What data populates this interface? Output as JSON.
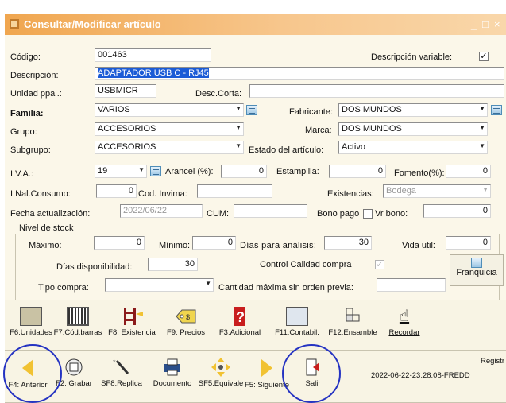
{
  "window": {
    "title": "Consultar/Modificar artículo",
    "controls": [
      "_",
      "□",
      "×"
    ]
  },
  "form": {
    "codigo_label": "Código:",
    "codigo_value": "001463",
    "desc_variable_label": "Descripción variable:",
    "desc_variable_checked": "✓",
    "descripcion_label": "Descripción:",
    "descripcion_value": "ADAPTADOR USB C - RJ45",
    "unidad_label": "Unidad ppal.:",
    "unidad_value": "USBMICR",
    "desc_corta_label": "Desc.Corta:",
    "desc_corta_value": "",
    "familia_label": "Familia:",
    "familia_value": "VARIOS",
    "fabricante_label": "Fabricante:",
    "fabricante_value": "DOS MUNDOS",
    "grupo_label": "Grupo:",
    "grupo_value": "ACCESORIOS",
    "marca_label": "Marca:",
    "marca_value": "DOS MUNDOS",
    "subgrupo_label": "Subgrupo:",
    "subgrupo_value": "ACCESORIOS",
    "estado_label": "Estado del artículo:",
    "estado_value": "Activo",
    "iva_label": "I.V.A.:",
    "iva_value": "19",
    "arancel_label": "Arancel (%):",
    "arancel_value": "0",
    "estampilla_label": "Estampilla:",
    "estampilla_value": "0",
    "fomento_label": "Fomento(%):",
    "fomento_value": "0",
    "inal_label": "I.Nal.Consumo:",
    "inal_value": "0",
    "invima_label": "Cod. Invima:",
    "invima_value": "",
    "existencias_label": "Existencias:",
    "existencias_value": "Bodega",
    "fecha_label": "Fecha actualización:",
    "fecha_value": "2022/06/22",
    "cum_label": "CUM:",
    "cum_value": "",
    "bono_label": "Bono pago",
    "vrbono_label": "Vr bono:",
    "vrbono_value": "0",
    "stock_label": "Nivel de stock",
    "maximo_label": "Máximo:",
    "maximo_value": "0",
    "minimo_label": "Mínimo:",
    "minimo_value": "0",
    "dias_analisis_label": "Días para análisis:",
    "dias_analisis_value": "30",
    "vida_label": "Vida util:",
    "vida_value": "0",
    "dias_disp_label": "Días disponibilidad:",
    "dias_disp_value": "30",
    "control_label": "Control Calidad compra",
    "control_checked": "✓",
    "franquicia_label": "Franquicia",
    "tipo_compra_label": "Tipo compra:",
    "tipo_compra_value": "",
    "cant_max_label": "Cantidad máxima sin orden previa:",
    "cant_max_value": ""
  },
  "toolbar1": [
    {
      "label": "F6:Unidades",
      "icon": "box-icon"
    },
    {
      "label": "F7:Cód.barras",
      "icon": "barcode-icon"
    },
    {
      "label": "F8: Existencia",
      "icon": "existencia-icon"
    },
    {
      "label": "F9: Precios",
      "icon": "prices-icon"
    },
    {
      "label": "F3:Adicional",
      "icon": "question-icon"
    },
    {
      "label": "F11:Contabil.",
      "icon": "calculator-icon"
    },
    {
      "label": "F12:Ensamble",
      "icon": "assembly-icon"
    },
    {
      "label": "Recordar",
      "icon": "hand-icon"
    }
  ],
  "toolbar2": [
    {
      "label": "F4: Anterior",
      "icon": "arrow-left-icon"
    },
    {
      "label": "F2: Grabar",
      "icon": "save-icon"
    },
    {
      "label": "SF8:Replica",
      "icon": "wand-icon"
    },
    {
      "label": "Documento",
      "icon": "printer-icon"
    },
    {
      "label": "SF5:Equivale",
      "icon": "equivalence-icon"
    },
    {
      "label": "F5: Siguiente",
      "icon": "arrow-right-icon"
    },
    {
      "label": "Salir",
      "icon": "exit-icon"
    }
  ],
  "status": {
    "registro_label": "Registr",
    "registro_value": "2022-06-22-23:28:08-FREDD"
  },
  "colors": {
    "title_gradient_start": "#f0a64f",
    "selection": "#1b5bd6",
    "annotation_circle": "#2533c2",
    "arrow": "#f1c232"
  }
}
